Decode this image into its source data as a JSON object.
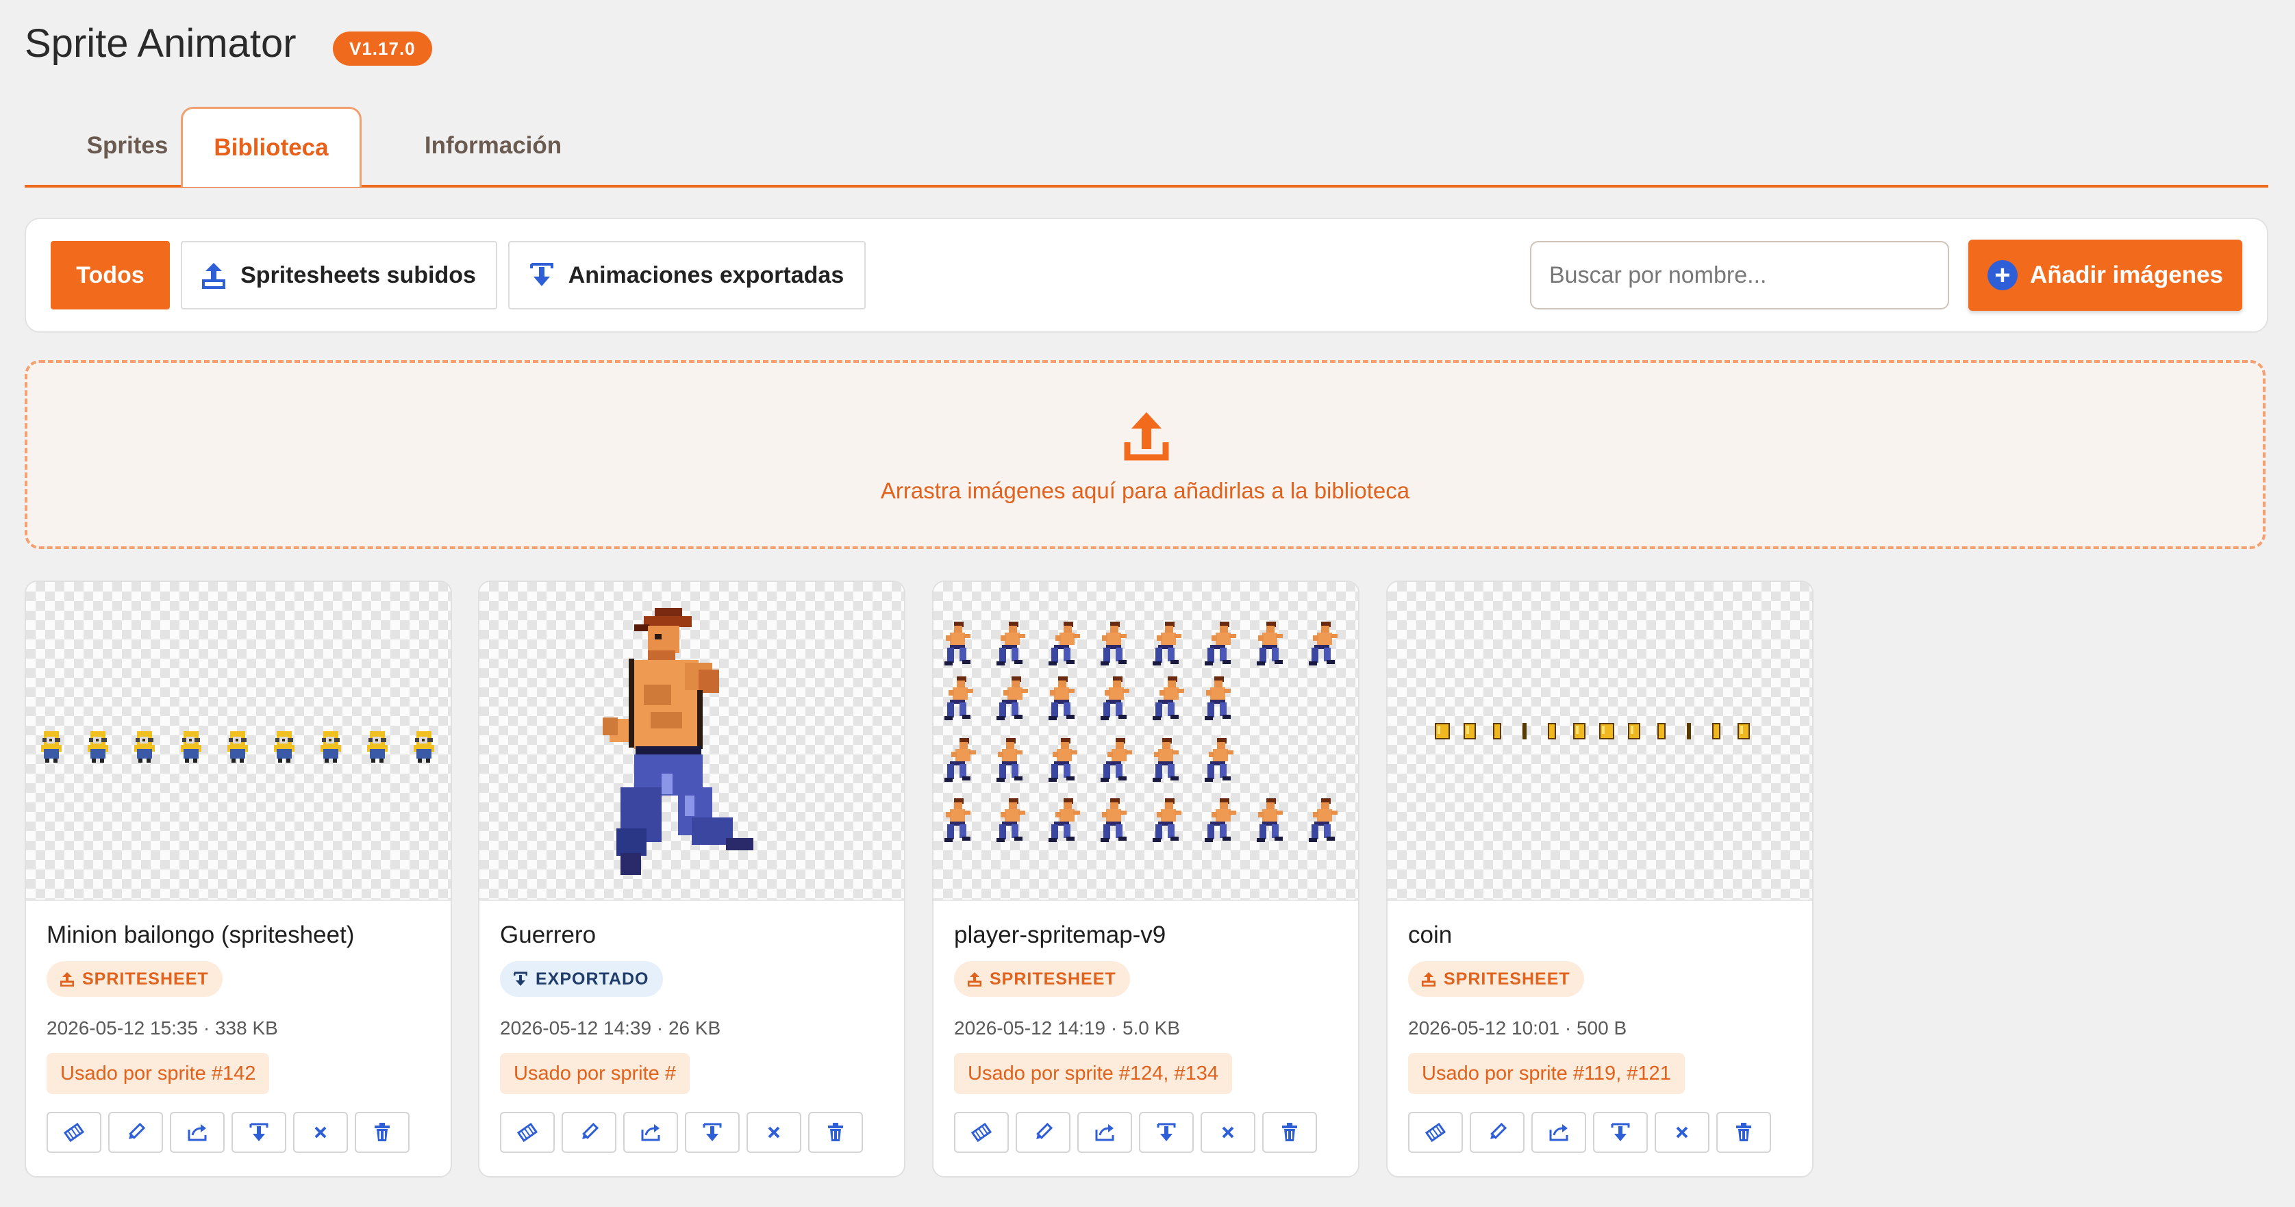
{
  "app": {
    "title": "Sprite Animator",
    "version": "V1.17.0"
  },
  "tabs": [
    {
      "label": "Sprites",
      "active": false
    },
    {
      "label": "Biblioteca",
      "active": true
    },
    {
      "label": "Información",
      "active": false
    }
  ],
  "toolbar": {
    "filters": [
      {
        "label": "Todos",
        "active": true,
        "icon": ""
      },
      {
        "label": "Spritesheets subidos",
        "active": false,
        "icon": "upload-icon"
      },
      {
        "label": "Animaciones exportadas",
        "active": false,
        "icon": "download-icon"
      }
    ],
    "search_placeholder": "Buscar por nombre...",
    "search_value": "",
    "add_label": "Añadir imágenes",
    "add_icon": "plus-circle-icon"
  },
  "dropzone": {
    "text": "Arrastra imágenes aquí para añadirlas a la biblioteca",
    "icon": "upload-icon"
  },
  "cards": [
    {
      "title": "Minion bailongo (spritesheet)",
      "badge": "SPRITESHEET",
      "badge_type": "spritesheet",
      "meta": "2026-05-12 15:35 · 338 KB",
      "usage": "Usado por sprite #142"
    },
    {
      "title": "Guerrero",
      "badge": "EXPORTADO",
      "badge_type": "exported",
      "meta": "2026-05-12 14:39 · 26 KB",
      "usage": "Usado por sprite #"
    },
    {
      "title": "player-spritemap-v9",
      "badge": "SPRITESHEET",
      "badge_type": "spritesheet",
      "meta": "2026-05-12 14:19 · 5.0 KB",
      "usage": "Usado por sprite #124, #134"
    },
    {
      "title": "coin",
      "badge": "SPRITESHEET",
      "badge_type": "spritesheet",
      "meta": "2026-05-12 10:01 · 500 B",
      "usage": "Usado por sprite #119, #121"
    }
  ],
  "card_actions": [
    "slice-icon",
    "edit-icon",
    "share-icon",
    "download-icon",
    "close-icon",
    "trash-icon"
  ],
  "colors": {
    "accent": "#f26b1d",
    "action_blue": "#2f5fd6",
    "badge_bg": "#fdebdc"
  }
}
